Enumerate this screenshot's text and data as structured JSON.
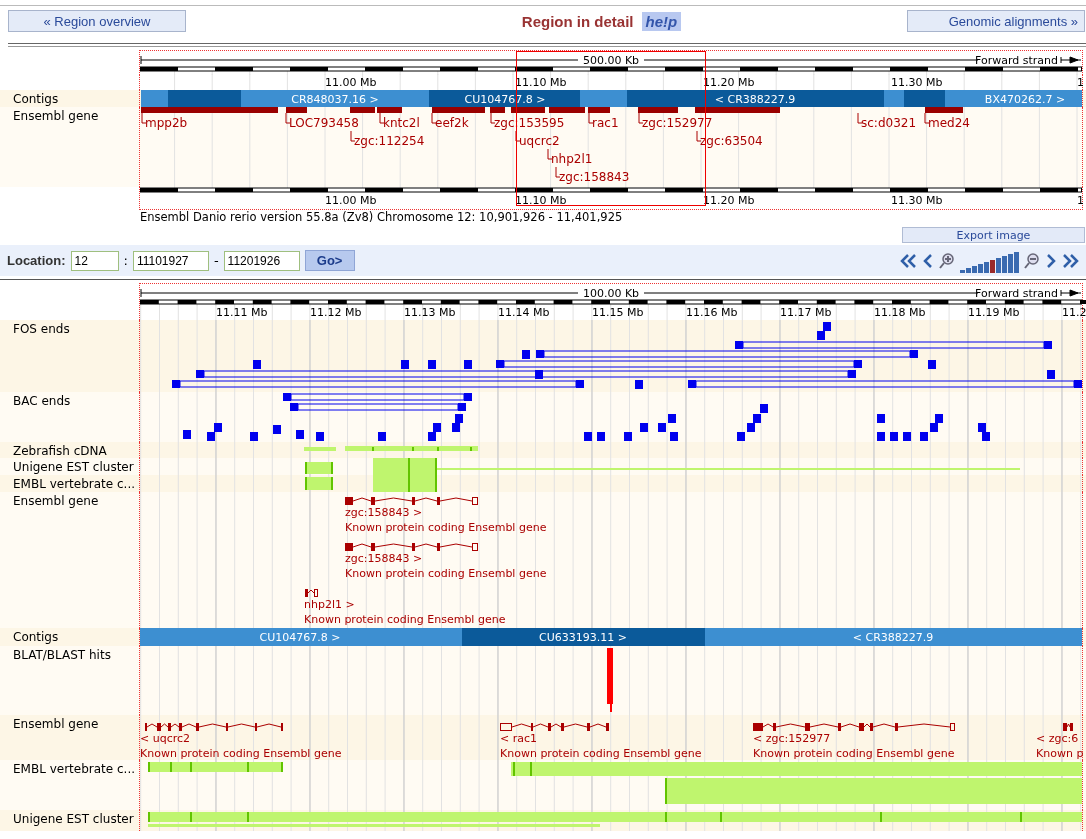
{
  "header": {
    "back_link": "« Region overview",
    "title": "Region in detail",
    "help": "he!p",
    "forward_link": "Genomic alignments »"
  },
  "overview": {
    "scale": "500.00 Kb",
    "strand": "Forward strand",
    "ticks": [
      "11.00 Mb",
      "11.10 Mb",
      "11.20 Mb",
      "11.30 Mb",
      "1"
    ],
    "bottom_ticks": [
      "11.00 Mb",
      "11.10 Mb",
      "11.20 Mb",
      "11.30 Mb",
      "1"
    ],
    "tracks": [
      {
        "label": "Contigs",
        "kind": "contig",
        "contigs": [
          "CR848037.16 >",
          "CU104767.8 >",
          "< CR388227.9",
          "BX470262.7 >"
        ]
      },
      {
        "label": "Ensembl gene",
        "kind": "gene",
        "genes": [
          "mpp2b",
          "LOC793458",
          "zgc:112254",
          "kntc2l",
          "eef2k",
          "zgc:153595",
          "uqcrc2",
          "nhp2l1",
          "zgc:158843",
          "rac1",
          "zgc:152977",
          "zgc:63504",
          "sc:d0321",
          "med24"
        ]
      }
    ],
    "caption": "Ensembl Danio rerio version 55.8a (Zv8) Chromosome 12: 10,901,926 - 11,401,925"
  },
  "export_button": "Export image",
  "location": {
    "label": "Location:",
    "chromosome": "12",
    "separator": ":",
    "start": "11101927",
    "dash": "-",
    "end": "11201926",
    "go": "Go>",
    "zoom_levels": [
      {
        "selected": false
      },
      {
        "selected": false
      },
      {
        "selected": false
      },
      {
        "selected": false
      },
      {
        "selected": false
      },
      {
        "selected": true
      },
      {
        "selected": false
      },
      {
        "selected": false
      },
      {
        "selected": false
      },
      {
        "selected": false
      }
    ]
  },
  "detail": {
    "scale": "100.00 Kb",
    "strand": "Forward strand",
    "ticks": [
      "11.11 Mb",
      "11.12 Mb",
      "11.13 Mb",
      "11.14 Mb",
      "11.15 Mb",
      "11.16 Mb",
      "11.17 Mb",
      "11.18 Mb",
      "11.19 Mb",
      "11.2"
    ],
    "tracks": [
      {
        "label": "FOS ends",
        "kind": "clones"
      },
      {
        "label": "BAC ends",
        "kind": "clones"
      },
      {
        "label": "Zebrafish cDNA",
        "kind": "alignment"
      },
      {
        "label": "Unigene EST cluster",
        "kind": "alignment"
      },
      {
        "label": "EMBL vertebrate c...",
        "kind": "alignment"
      },
      {
        "label": "Ensembl gene",
        "kind": "gene",
        "genes": [
          {
            "name": "zgc:158843 >",
            "description": "Known protein coding Ensembl gene"
          },
          {
            "name": "zgc:158843 >",
            "description": "Known protein coding Ensembl gene"
          },
          {
            "name": "nhp2l1 >",
            "description": "Known protein coding Ensembl gene"
          }
        ]
      },
      {
        "label": "Contigs",
        "kind": "contig",
        "contigs": [
          "CU104767.8 >",
          "CU633193.11 >",
          "< CR388227.9"
        ]
      },
      {
        "label": "BLAT/BLAST hits",
        "kind": "hits"
      },
      {
        "label": "Ensembl gene",
        "kind": "gene",
        "genes": [
          {
            "name": "< uqcrc2",
            "description": "Known protein coding Ensembl gene"
          },
          {
            "name": "< rac1",
            "description": "Known protein coding Ensembl gene"
          },
          {
            "name": "< zgc:152977",
            "description": "Known protein coding Ensembl gene"
          },
          {
            "name": "< zgc:6",
            "description": "Known p"
          }
        ]
      },
      {
        "label": "EMBL vertebrate c...",
        "kind": "alignment"
      },
      {
        "label": "Unigene EST cluster",
        "kind": "alignment"
      }
    ]
  }
}
